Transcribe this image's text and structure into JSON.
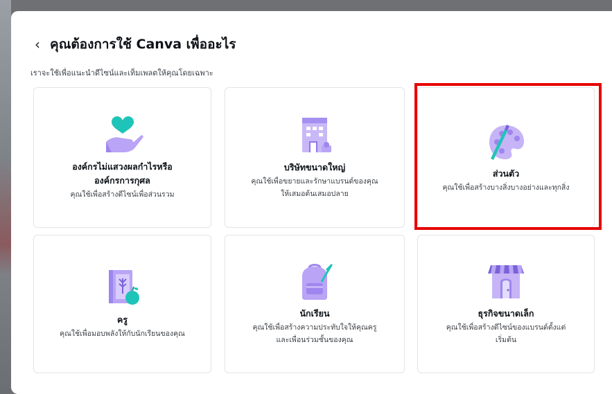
{
  "header": {
    "back_icon": "chevron-left-icon",
    "title": "คุณต้องการใช้ Canva เพื่ออะไร"
  },
  "subtitle": "เราจะใช้เพื่อแนะนำดีไซน์และเท็มเพลตให้คุณโดยเฉพาะ",
  "colors": {
    "accent_purple": "#b9a4f5",
    "accent_teal": "#1fc4b8",
    "highlight_red": "#e60000"
  },
  "cards": [
    {
      "icon": "heart-in-hand-icon",
      "title": "องค์กรไม่แสวงผลกำไรหรือ\nองค์กรการกุศล",
      "desc": "คุณใช้เพื่อสร้างดีไซน์เพื่อส่วนรวม"
    },
    {
      "icon": "office-building-icon",
      "title": "บริษัทขนาดใหญ่",
      "desc": "คุณใช้เพื่อขยายและรักษาแบรนด์ของคุณ\nให้เสมอต้นเสมอปลาย"
    },
    {
      "icon": "paint-palette-icon",
      "title": "ส่วนตัว",
      "desc": "คุณใช้เพื่อสร้างบางสิ่งบางอย่างและทุกสิ่ง",
      "highlighted": true
    },
    {
      "icon": "notebook-apple-icon",
      "title": "ครู",
      "desc": "คุณใช้เพื่อมอบพลังให้กับนักเรียนของคุณ"
    },
    {
      "icon": "backpack-icon",
      "title": "นักเรียน",
      "desc": "คุณใช้เพื่อสร้างความประทับใจให้คุณครู\nและเพื่อนร่วมชั้นของคุณ"
    },
    {
      "icon": "small-shop-icon",
      "title": "ธุรกิจขนาดเล็ก",
      "desc": "คุณใช้เพื่อสร้างดีไซน์ของแบรนด์ตั้งแต่\nเริ่มต้น"
    }
  ]
}
